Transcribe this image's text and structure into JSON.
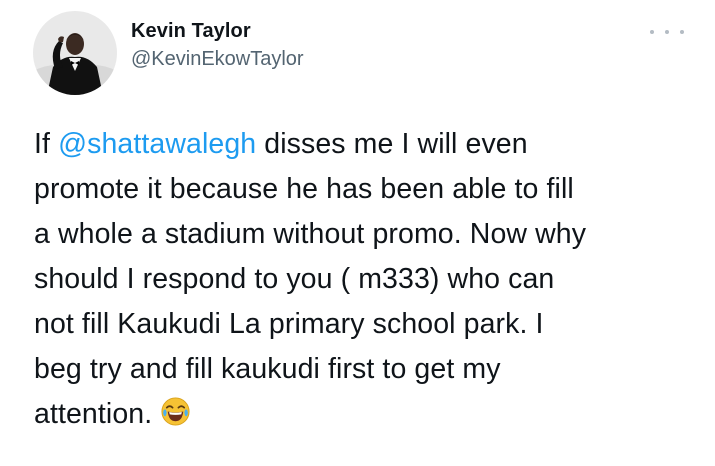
{
  "author": {
    "display_name": "Kevin Taylor",
    "handle": "@KevinEkowTaylor",
    "avatar_icon": "profile-photo"
  },
  "menu": {
    "icon": "more-options-icon"
  },
  "tweet": {
    "lines": [
      {
        "before": "If ",
        "mention": "@shattawalegh",
        "after": " disses me I will even"
      },
      "promote it because he has been able to fill",
      "a whole a stadium without promo. Now why",
      "should I respond to you ( m333) who can",
      "not fill Kaukudi La primary school park. I",
      "beg try and fill kaukudi  first to get my",
      "attention."
    ],
    "emoji": "face-with-tears-of-joy"
  },
  "colors": {
    "text": "#0f1419",
    "secondary": "#536471",
    "link": "#1d9bf0",
    "background": "#ffffff"
  }
}
